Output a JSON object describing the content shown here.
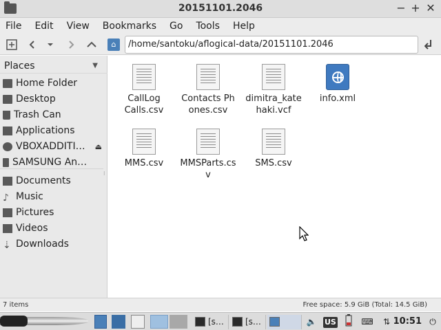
{
  "window": {
    "title": "20151101.2046",
    "minimize_glyph": "−",
    "maximize_glyph": "+",
    "close_glyph": "✕"
  },
  "menu": [
    "File",
    "Edit",
    "View",
    "Bookmarks",
    "Go",
    "Tools",
    "Help"
  ],
  "toolbar": {
    "path": "/home/santoku/aflogical-data/20151101.2046"
  },
  "sidebar": {
    "header": "Places",
    "items": [
      {
        "label": "Home Folder",
        "icon": "home-folder-icon"
      },
      {
        "label": "Desktop",
        "icon": "desktop-icon"
      },
      {
        "label": "Trash Can",
        "icon": "trash-icon"
      },
      {
        "label": "Applications",
        "icon": "applications-icon"
      },
      {
        "label": "VBOXADDITI…",
        "icon": "disc-icon",
        "eject": "⏏"
      },
      {
        "label": "SAMSUNG An…",
        "icon": "phone-icon"
      },
      {
        "label": "Documents",
        "icon": "documents-icon"
      },
      {
        "label": "Music",
        "icon": "music-icon"
      },
      {
        "label": "Pictures",
        "icon": "pictures-icon"
      },
      {
        "label": "Videos",
        "icon": "videos-icon"
      },
      {
        "label": "Downloads",
        "icon": "downloads-icon"
      }
    ]
  },
  "files": [
    {
      "name": "CallLog Calls.csv",
      "type": "text"
    },
    {
      "name": "Contacts Phones.csv",
      "type": "text"
    },
    {
      "name": "dimitra_katehaki.vcf",
      "type": "text"
    },
    {
      "name": "info.xml",
      "type": "web"
    },
    {
      "name": "MMS.csv",
      "type": "text"
    },
    {
      "name": "MMSParts.csv",
      "type": "text"
    },
    {
      "name": "SMS.csv",
      "type": "text"
    }
  ],
  "status": {
    "items": "7 items",
    "free_space": "Free space: 5.9 GiB (Total: 14.5 GiB)"
  },
  "taskbar": {
    "terminal1": "[s…",
    "terminal2": "[s…",
    "filemanager": "",
    "keyboard_layout": "US",
    "clock": "10:51"
  }
}
